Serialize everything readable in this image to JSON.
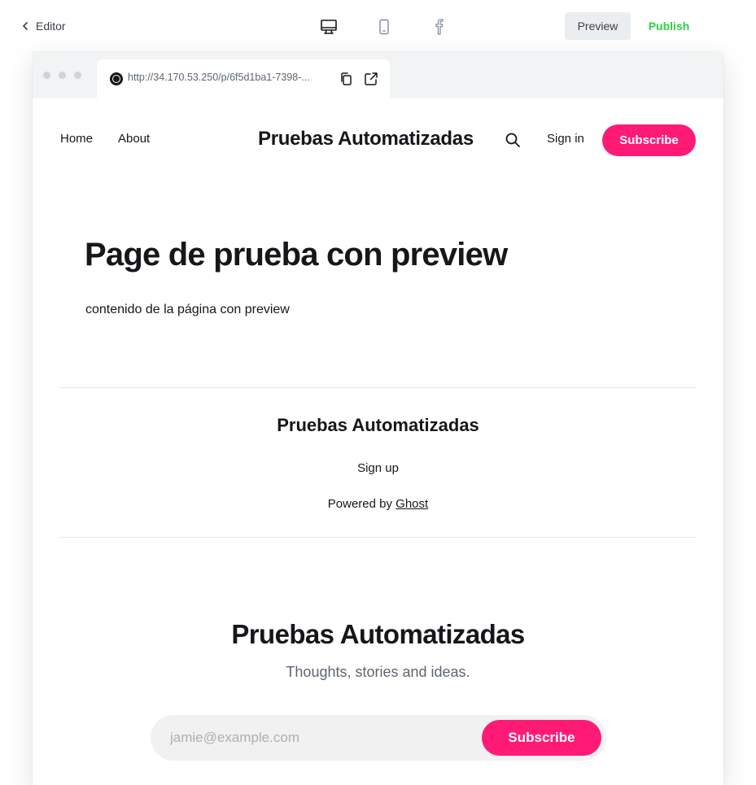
{
  "editor": {
    "back_label": "Editor",
    "preview_label": "Preview",
    "publish_label": "Publish",
    "publish_color": "#30cf43",
    "devices": [
      "desktop-icon",
      "mobile-icon",
      "facebook-icon"
    ]
  },
  "browser": {
    "url": "http://34.170.53.250/p/6f5d1ba1-7398-..."
  },
  "site": {
    "nav": {
      "home": "Home",
      "about": "About"
    },
    "title": "Pruebas Automatizadas",
    "signin": "Sign in",
    "subscribe": "Subscribe",
    "accent_color": "#ff1a75"
  },
  "page": {
    "title": "Page de prueba con preview",
    "body": "contenido de la página con preview"
  },
  "footer": {
    "title": "Pruebas Automatizadas",
    "signup": "Sign up",
    "powered_prefix": "Powered by ",
    "powered_link": "Ghost"
  },
  "cta": {
    "title": "Pruebas Automatizadas",
    "description": "Thoughts, stories and ideas.",
    "email_placeholder": "jamie@example.com",
    "button": "Subscribe"
  }
}
